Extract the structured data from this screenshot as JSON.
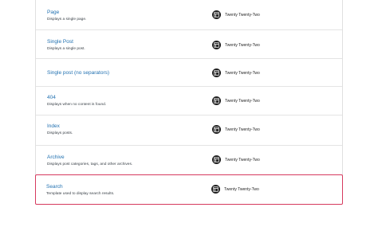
{
  "templates": [
    {
      "title": "Page",
      "description": "Displays a single page.",
      "author": "Twenty Twenty-Two"
    },
    {
      "title": "Single Post",
      "description": "Displays a single post.",
      "author": "Twenty Twenty-Two"
    },
    {
      "title": "Single post (no separators)",
      "description": "",
      "author": "Twenty Twenty-Two"
    },
    {
      "title": "404",
      "description": "Displays when no content is found.",
      "author": "Twenty Twenty-Two"
    },
    {
      "title": "Index",
      "description": "Displays posts.",
      "author": "Twenty Twenty-Two"
    },
    {
      "title": "Archive",
      "description": "Displays post categories, tags, and other archives.",
      "author": "Twenty Twenty-Two"
    },
    {
      "title": "Search",
      "description": "Template used to display search results.",
      "author": "Twenty Twenty-Two"
    }
  ],
  "author_icon": "layout-icon",
  "highlight_color": "#d63a5e",
  "link_color": "#2271b1"
}
